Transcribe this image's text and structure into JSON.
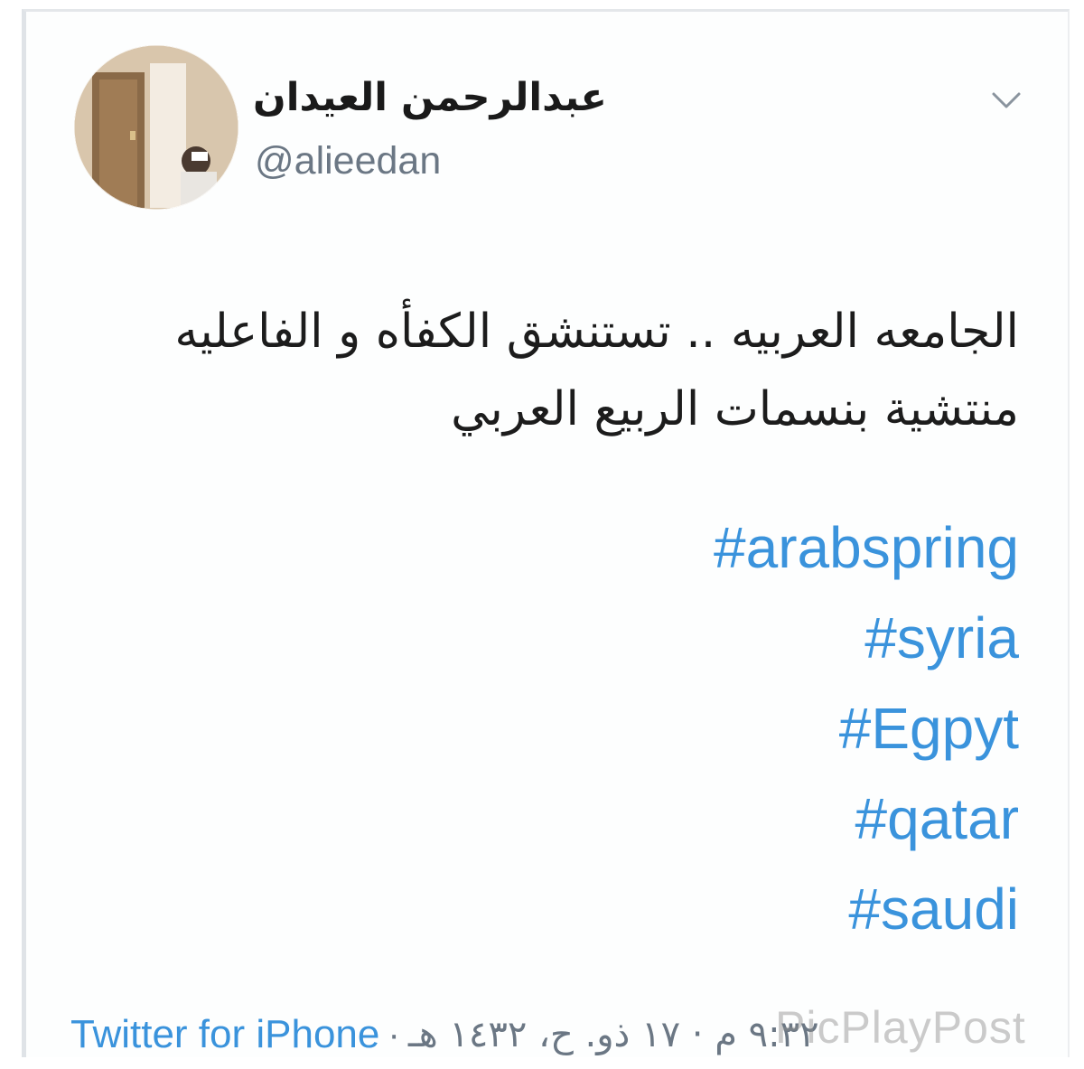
{
  "tweet": {
    "author": {
      "display_name": "عبدالرحمن العيدان",
      "handle": "@alieedan",
      "avatar_icon": "profile-photo"
    },
    "menu_icon": "chevron-down-icon",
    "text_lines": [
      "الجامعه العربيه .. تستنشق الكفأه و الفاعليه",
      "منتشية بنسمات الربيع العربي"
    ],
    "hashtags": [
      "#arabspring",
      "#syria",
      "#Egpyt",
      "#qatar",
      "#saudi"
    ],
    "footer": {
      "source": "Twitter for iPhone",
      "separator": "·",
      "timestamp": "٩:٣٢ م · ١٧ ذو. ح، ١٤٣٢ هـ"
    }
  },
  "watermark": "PicPlayPost",
  "colors": {
    "link": "#3a93dc",
    "secondary_text": "#6b7784",
    "primary_text": "#1c1c1c"
  }
}
